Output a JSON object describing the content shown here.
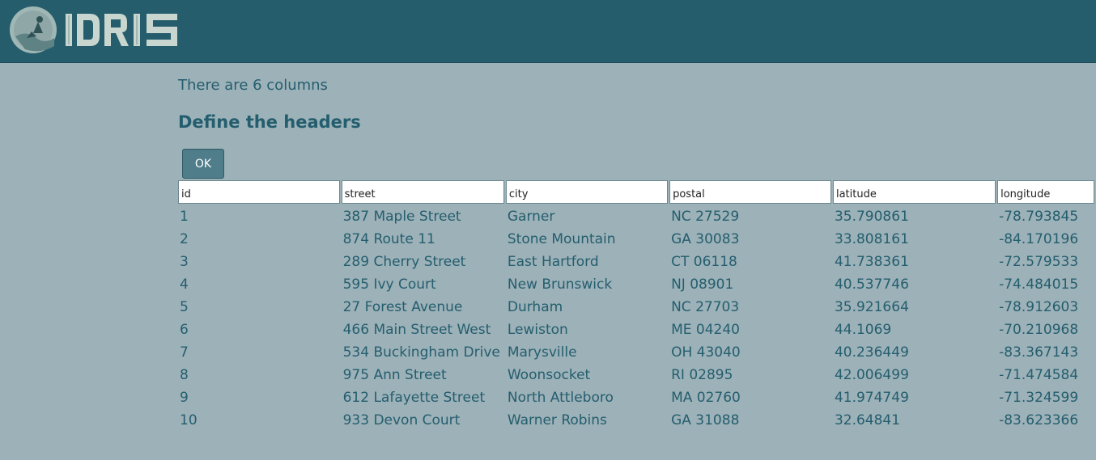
{
  "brand": {
    "name": "IDRIS",
    "colors": {
      "header_bg": "#255d6c",
      "page_bg": "#9db1b8",
      "text": "#245e6e",
      "button": "#4f7d89"
    }
  },
  "info": {
    "columns_text": "There are 6 columns"
  },
  "page": {
    "title": "Define the headers"
  },
  "actions": {
    "ok_label": "OK"
  },
  "table": {
    "headers": [
      "id",
      "street",
      "city",
      "postal",
      "latitude",
      "longitude"
    ],
    "rows": [
      [
        "1",
        "387 Maple Street",
        "Garner",
        "NC 27529",
        "35.790861",
        "-78.793845"
      ],
      [
        "2",
        "874 Route 11",
        "Stone Mountain",
        "GA 30083",
        "33.808161",
        "-84.170196"
      ],
      [
        "3",
        "289 Cherry Street",
        "East Hartford",
        "CT 06118",
        "41.738361",
        "-72.579533"
      ],
      [
        "4",
        "595 Ivy Court",
        "New Brunswick",
        "NJ 08901",
        "40.537746",
        "-74.484015"
      ],
      [
        "5",
        "27 Forest Avenue",
        "Durham",
        "NC 27703",
        "35.921664",
        "-78.912603"
      ],
      [
        "6",
        "466 Main Street West",
        "Lewiston",
        "ME 04240",
        "44.1069",
        "-70.210968"
      ],
      [
        "7",
        "534 Buckingham Drive",
        "Marysville",
        "OH 43040",
        "40.236449",
        "-83.367143"
      ],
      [
        "8",
        "975 Ann Street",
        "Woonsocket",
        "RI 02895",
        "42.006499",
        "-71.474584"
      ],
      [
        "9",
        "612 Lafayette Street",
        "North Attleboro",
        "MA 02760",
        "41.974749",
        "-71.324599"
      ],
      [
        "10",
        "933 Devon Court",
        "Warner Robins",
        "GA 31088",
        "32.64841",
        "-83.623366"
      ]
    ]
  }
}
